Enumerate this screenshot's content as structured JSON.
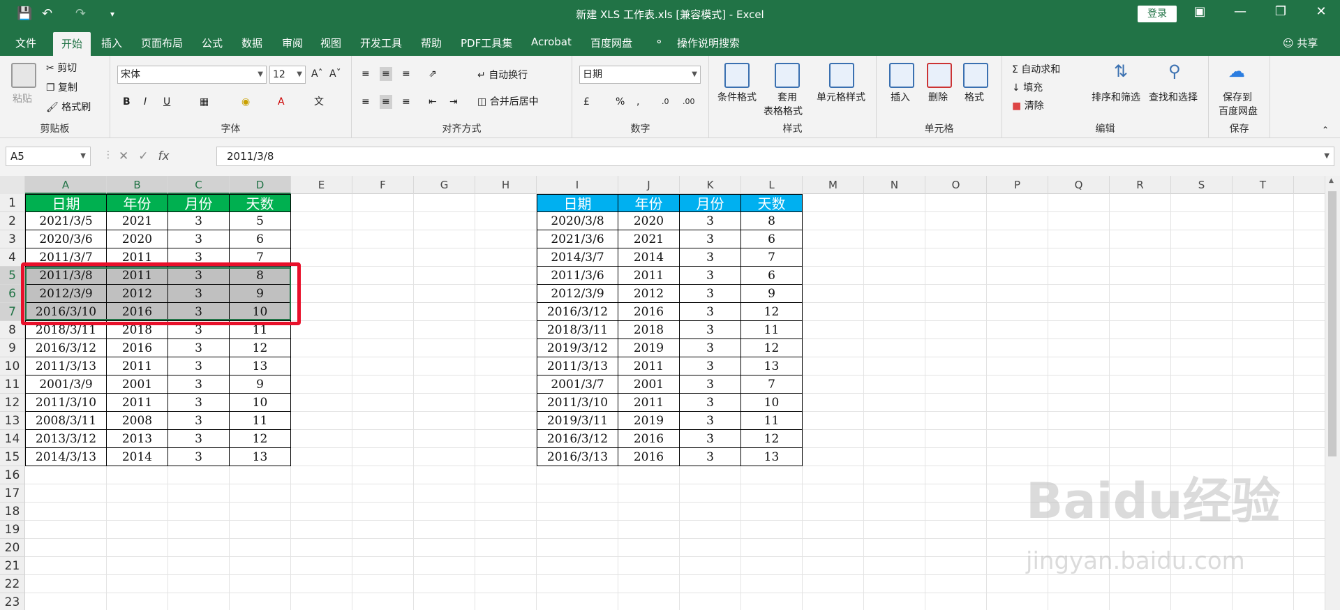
{
  "window": {
    "title": "新建 XLS 工作表.xls  [兼容模式]  -  Excel",
    "login_label": "登录"
  },
  "ribbon_tabs": [
    "文件",
    "开始",
    "插入",
    "页面布局",
    "公式",
    "数据",
    "审阅",
    "视图",
    "开发工具",
    "帮助",
    "PDF工具集",
    "Acrobat",
    "百度网盘",
    "操作说明搜索"
  ],
  "share_label": "共享",
  "clipboard": {
    "paste": "粘贴",
    "cut": "剪切",
    "copy": "复制",
    "painter": "格式刷",
    "label": "剪贴板"
  },
  "font": {
    "name": "宋体",
    "size": "12",
    "label": "字体"
  },
  "alignment": {
    "wrap": "自动换行",
    "merge": "合并后居中",
    "label": "对齐方式"
  },
  "number": {
    "format": "日期",
    "label": "数字"
  },
  "styles": {
    "cond": "条件格式",
    "table": "套用",
    "table2": "表格格式",
    "cell": "单元格样式",
    "label": "样式"
  },
  "cells": {
    "insert": "插入",
    "delete": "删除",
    "format": "格式",
    "label": "单元格"
  },
  "editing": {
    "autosum": "自动求和",
    "fill": "填充",
    "clear": "清除",
    "sort": "排序和筛选",
    "find": "查找和选择",
    "label": "编辑"
  },
  "save": {
    "line1": "保存到",
    "line2": "百度网盘",
    "label": "保存"
  },
  "formula_bar": {
    "name_box": "A5",
    "fx": "fx",
    "formula": "2011/3/8"
  },
  "columns": [
    "A",
    "B",
    "C",
    "D",
    "E",
    "F",
    "G",
    "H",
    "I",
    "J",
    "K",
    "L",
    "M",
    "N",
    "O",
    "P",
    "Q",
    "R",
    "S",
    "T"
  ],
  "rows": [
    "1",
    "2",
    "3",
    "4",
    "5",
    "6",
    "7",
    "8",
    "9",
    "10",
    "11",
    "12",
    "13",
    "14",
    "15",
    "16",
    "17",
    "18",
    "19",
    "20",
    "21",
    "22",
    "23"
  ],
  "colors": {
    "left_header": "#00b050",
    "right_header": "#00b0f0",
    "selection": "#c0c0c0",
    "highlight": "#e8102a"
  },
  "left_table": {
    "headers": [
      "日期",
      "年份",
      "月份",
      "天数"
    ],
    "rows": [
      [
        "2021/3/5",
        "2021",
        "3",
        "5"
      ],
      [
        "2020/3/6",
        "2020",
        "3",
        "6"
      ],
      [
        "2011/3/7",
        "2011",
        "3",
        "7"
      ],
      [
        "2011/3/8",
        "2011",
        "3",
        "8"
      ],
      [
        "2012/3/9",
        "2012",
        "3",
        "9"
      ],
      [
        "2016/3/10",
        "2016",
        "3",
        "10"
      ],
      [
        "2018/3/11",
        "2018",
        "3",
        "11"
      ],
      [
        "2016/3/12",
        "2016",
        "3",
        "12"
      ],
      [
        "2011/3/13",
        "2011",
        "3",
        "13"
      ],
      [
        "2001/3/9",
        "2001",
        "3",
        "9"
      ],
      [
        "2011/3/10",
        "2011",
        "3",
        "10"
      ],
      [
        "2008/3/11",
        "2008",
        "3",
        "11"
      ],
      [
        "2013/3/12",
        "2013",
        "3",
        "12"
      ],
      [
        "2014/3/13",
        "2014",
        "3",
        "13"
      ]
    ]
  },
  "right_table": {
    "headers": [
      "日期",
      "年份",
      "月份",
      "天数"
    ],
    "rows": [
      [
        "2020/3/8",
        "2020",
        "3",
        "8"
      ],
      [
        "2021/3/6",
        "2021",
        "3",
        "6"
      ],
      [
        "2014/3/7",
        "2014",
        "3",
        "7"
      ],
      [
        "2011/3/6",
        "2011",
        "3",
        "6"
      ],
      [
        "2012/3/9",
        "2012",
        "3",
        "9"
      ],
      [
        "2016/3/12",
        "2016",
        "3",
        "12"
      ],
      [
        "2018/3/11",
        "2018",
        "3",
        "11"
      ],
      [
        "2019/3/12",
        "2019",
        "3",
        "12"
      ],
      [
        "2011/3/13",
        "2011",
        "3",
        "13"
      ],
      [
        "2001/3/7",
        "2001",
        "3",
        "7"
      ],
      [
        "2011/3/10",
        "2011",
        "3",
        "10"
      ],
      [
        "2019/3/11",
        "2019",
        "3",
        "11"
      ],
      [
        "2016/3/12",
        "2016",
        "3",
        "12"
      ],
      [
        "2016/3/13",
        "2016",
        "3",
        "13"
      ]
    ]
  },
  "watermark": {
    "logo": "Baidu经验",
    "url": "jingyan.baidu.com"
  }
}
